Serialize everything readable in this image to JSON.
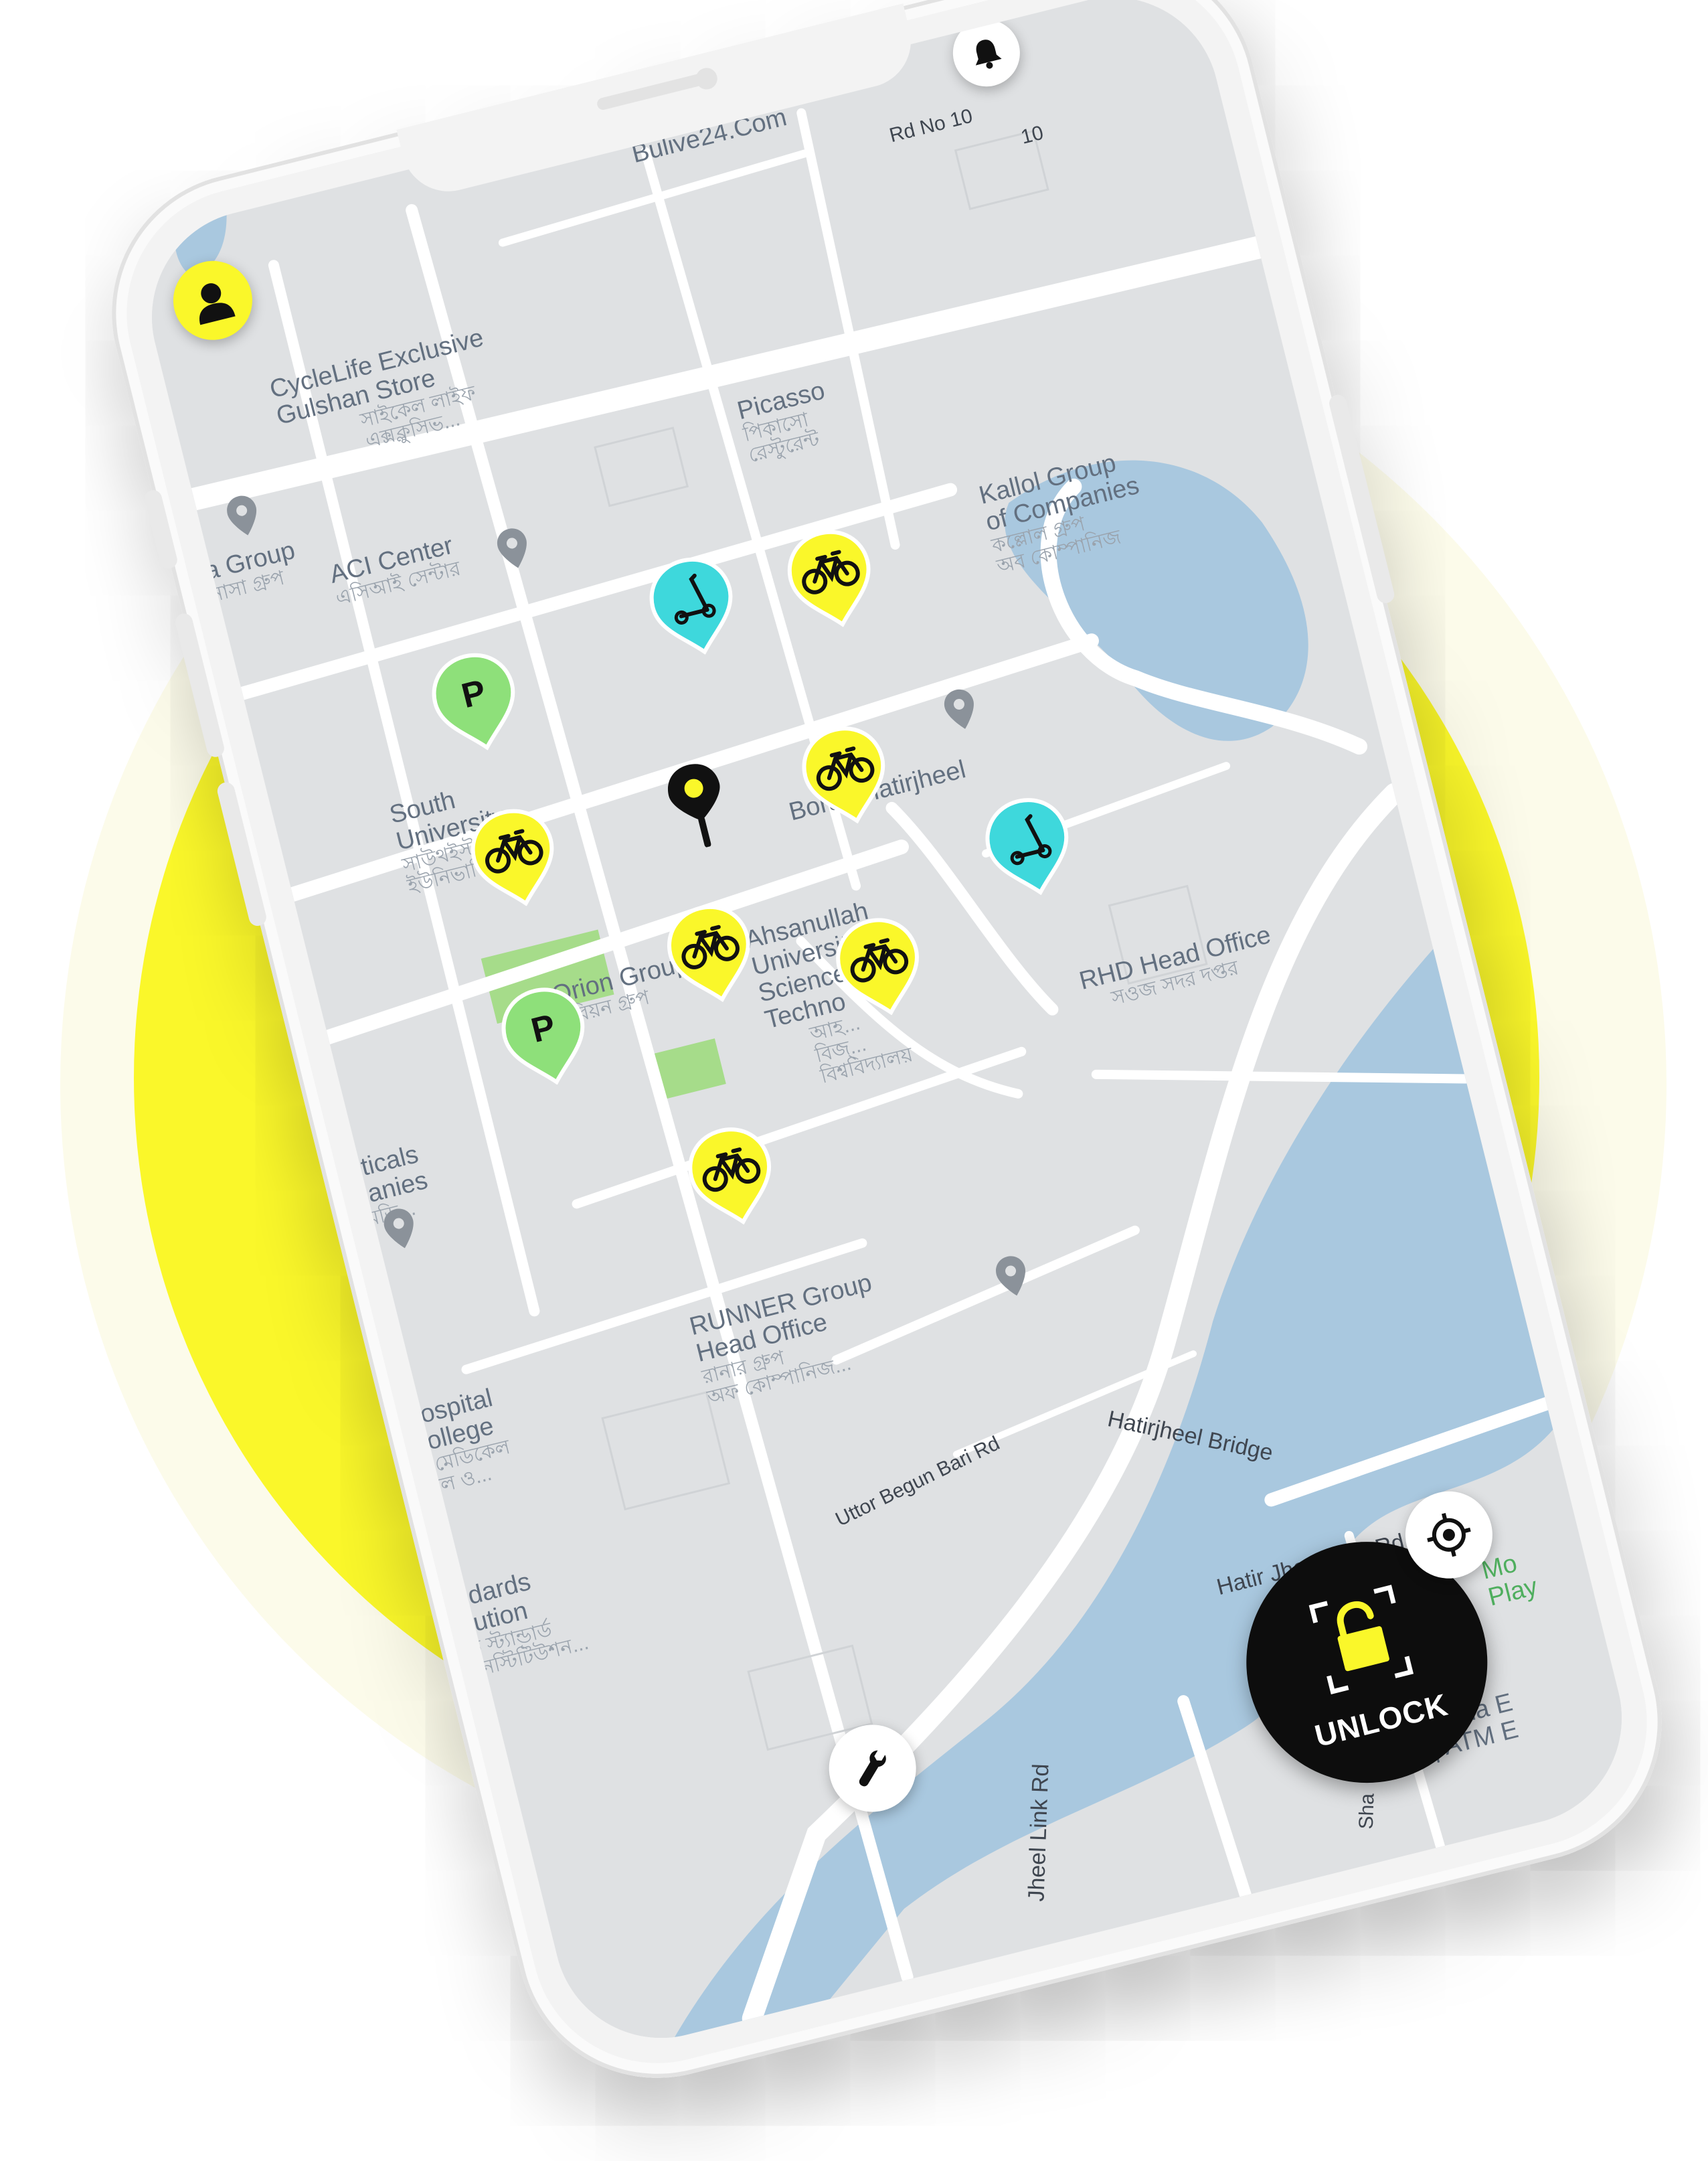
{
  "app": {
    "accent_color": "#faf72a",
    "park_color": "#8ee07a",
    "scooter_color": "#3ed8dc",
    "pin_color": "#111111"
  },
  "header": {
    "profile_icon": "user-icon",
    "notifications_icon": "bell-icon"
  },
  "map": {
    "places": [
      {
        "key": "bulive",
        "en": "Bulive24.Com"
      },
      {
        "key": "rd10",
        "en": "Rd No 10"
      },
      {
        "key": "ten",
        "en": "10"
      },
      {
        "key": "cyclelife",
        "en": "CycleLife Exclusive\nGulshan Store",
        "bn": "সাইকেল লাইফ\nএক্সক্লুসিভ..."
      },
      {
        "key": "picasso",
        "en": "Picasso",
        "bn": "পিকাসো\nরেস্টুরেন্ট"
      },
      {
        "key": "group",
        "en": "a Group",
        "bn": "নাসা গ্রুপ"
      },
      {
        "key": "aci",
        "en": "ACI Center",
        "bn": "এসিআই সেন্টার"
      },
      {
        "key": "kallol",
        "en": "Kallol Group\nof Companies",
        "bn": "কল্লোল গ্রুপ\nঅব কোম্পানিজ"
      },
      {
        "key": "southeast",
        "en": "South\nUniversity",
        "bn": "সাউথইস্ট\nইউনিভার্সিটি"
      },
      {
        "key": "borak",
        "en": "Borak Hatirjheel"
      },
      {
        "key": "orion",
        "en": "Orion Group",
        "bn": "ওরিয়ন গ্রুপ"
      },
      {
        "key": "ahsanullah",
        "en": "Ahsanullah\nUniversity of\nScience and\nTechno",
        "bn": "আহ...\nবিজ্...\nবিশ্ববিদ্যালয়"
      },
      {
        "key": "opticals",
        "en": "pticals\nnanies",
        "bn": "মেডি..."
      },
      {
        "key": "rhd",
        "en": "RHD Head Office",
        "bn": "সওজ সদর দপ্তর"
      },
      {
        "key": "hospital",
        "en": "Hospital\nCollege",
        "bn": "ক্স মেডিকেল\nতাল ও..."
      },
      {
        "key": "runner",
        "en": "RUNNER Group\nHead Office",
        "bn": "রানার গ্রুপ\nঅফ কোম্পানিজ..."
      },
      {
        "key": "standards",
        "en": "ndards\nitution",
        "bn": "ড স্ট্যান্ডার্ড\nইনস্টিটিউশন..."
      },
      {
        "key": "uttor",
        "en": "Uttor Begun Bari Rd"
      },
      {
        "key": "bridge",
        "en": "Hatirjheel Bridge"
      },
      {
        "key": "link",
        "en": "Hatir Jheel Link Rd"
      },
      {
        "key": "jheel",
        "en": "Jheel Link Rd"
      },
      {
        "key": "moti",
        "en": "Mo\nPlay"
      },
      {
        "key": "dbbl",
        "en": "Dutch-Bangla E\nLimited | ATM E"
      },
      {
        "key": "sha",
        "en": "Sha"
      }
    ],
    "markers": [
      {
        "type": "scooter",
        "icon": "scooter-icon"
      },
      {
        "type": "bike",
        "icon": "bicycle-icon"
      },
      {
        "type": "park",
        "label": "P",
        "icon": "parking-icon"
      },
      {
        "type": "bike",
        "icon": "bicycle-icon"
      },
      {
        "type": "bike",
        "icon": "bicycle-icon"
      },
      {
        "type": "bike",
        "icon": "bicycle-icon"
      },
      {
        "type": "scooter",
        "icon": "scooter-icon"
      },
      {
        "type": "park",
        "label": "P",
        "icon": "parking-icon"
      },
      {
        "type": "bike",
        "icon": "bicycle-icon"
      },
      {
        "type": "bike",
        "icon": "bicycle-icon"
      }
    ],
    "current_location_icon": "location-pin-icon"
  },
  "controls": {
    "report_icon": "wrench-icon",
    "locate_icon": "crosshair-icon",
    "unlock_label": "UNLOCK",
    "unlock_icon": "scan-lock-icon"
  }
}
